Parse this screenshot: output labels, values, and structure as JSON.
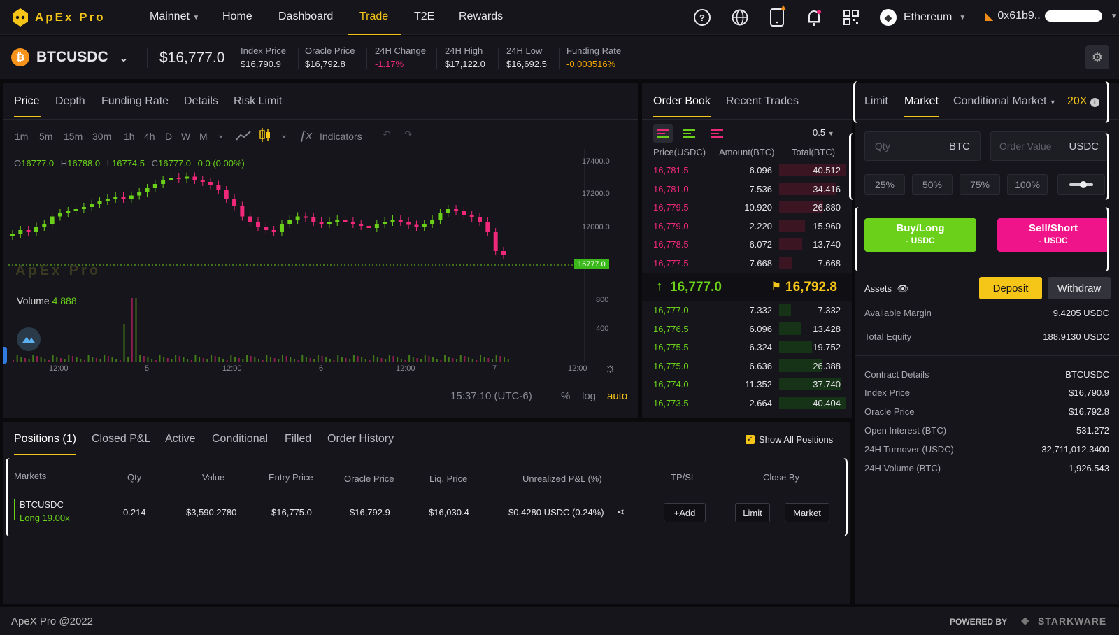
{
  "header": {
    "brand": "ApEx Pro",
    "network": "Mainnet",
    "nav": [
      "Home",
      "Dashboard",
      "Trade",
      "T2E",
      "Rewards"
    ],
    "chain": "Ethereum",
    "wallet": "0x61b9.."
  },
  "ticker": {
    "symbol": "BTCUSDC",
    "last_price": "$16,777.0",
    "stats": [
      {
        "label": "Index Price",
        "value": "$16,790.9"
      },
      {
        "label": "Oracle Price",
        "value": "$16,792.8"
      },
      {
        "label": "24H Change",
        "value": "-1.17%"
      },
      {
        "label": "24H High",
        "value": "$17,122.0"
      },
      {
        "label": "24H Low",
        "value": "$16,692.5"
      },
      {
        "label": "Funding Rate",
        "value": "-0.003516%"
      }
    ]
  },
  "chart": {
    "tabs": [
      "Price",
      "Depth",
      "Funding Rate",
      "Details",
      "Risk Limit"
    ],
    "intervals": [
      "1m",
      "5m",
      "15m",
      "30m",
      "1h",
      "4h",
      "D",
      "W",
      "M"
    ],
    "active_interval": "30m",
    "indicators_label": "Indicators",
    "ohlc": {
      "o_label": "O",
      "o": "16777.0",
      "h_label": "H",
      "h": "16788.0",
      "l_label": "L",
      "l": "16774.5",
      "c_label": "C",
      "c": "16777.0",
      "chg": "0.0 (0.00%)"
    },
    "volume_label": "Volume",
    "volume_value": "4.888",
    "price_ticks": [
      "17400.0",
      "17200.0",
      "17000.0"
    ],
    "last_price_tag": "16777.0",
    "volume_ticks": [
      "800",
      "400"
    ],
    "time_ticks": [
      "12:00",
      "5",
      "12:00",
      "6",
      "12:00",
      "7",
      "12:00"
    ],
    "clock": "15:37:10 (UTC-6)",
    "scale_options": [
      "%",
      "log",
      "auto"
    ],
    "watermark": "ApEx Pro"
  },
  "orderbook": {
    "tabs": [
      "Order Book",
      "Recent Trades"
    ],
    "precision": "0.5",
    "columns": [
      "Price(USDC)",
      "Amount(BTC)",
      "Total(BTC)"
    ],
    "asks": [
      {
        "price": "16,781.5",
        "amount": "6.096",
        "total": "40.512",
        "depth": 1.0
      },
      {
        "price": "16,781.0",
        "amount": "7.536",
        "total": "34.416",
        "depth": 0.85
      },
      {
        "price": "16,779.5",
        "amount": "10.920",
        "total": "26.880",
        "depth": 0.66
      },
      {
        "price": "16,779.0",
        "amount": "2.220",
        "total": "15.960",
        "depth": 0.39
      },
      {
        "price": "16,778.5",
        "amount": "6.072",
        "total": "13.740",
        "depth": 0.34
      },
      {
        "price": "16,777.5",
        "amount": "7.668",
        "total": "7.668",
        "depth": 0.19
      }
    ],
    "mid_last": "16,777.0",
    "mid_mark": "16,792.8",
    "bids": [
      {
        "price": "16,777.0",
        "amount": "7.332",
        "total": "7.332",
        "depth": 0.18
      },
      {
        "price": "16,776.5",
        "amount": "6.096",
        "total": "13.428",
        "depth": 0.33
      },
      {
        "price": "16,775.5",
        "amount": "6.324",
        "total": "19.752",
        "depth": 0.49
      },
      {
        "price": "16,775.0",
        "amount": "6.636",
        "total": "26.388",
        "depth": 0.65
      },
      {
        "price": "16,774.0",
        "amount": "11.352",
        "total": "37.740",
        "depth": 0.93
      },
      {
        "price": "16,773.5",
        "amount": "2.664",
        "total": "40.404",
        "depth": 1.0
      }
    ]
  },
  "trade": {
    "tabs": [
      "Limit",
      "Market",
      "Conditional Market"
    ],
    "leverage": "20X",
    "qty_placeholder": "Qty",
    "qty_unit": "BTC",
    "value_placeholder": "Order Value",
    "value_unit": "USDC",
    "percents": [
      "25%",
      "50%",
      "75%",
      "100%"
    ],
    "buy_label": "Buy/Long",
    "buy_sub": "- USDC",
    "sell_label": "Sell/Short",
    "sell_sub": "- USDC",
    "assets_label": "Assets",
    "deposit": "Deposit",
    "withdraw": "Withdraw",
    "account": [
      {
        "k": "Available Margin",
        "v": "9.4205 USDC"
      },
      {
        "k": "Total Equity",
        "v": "188.9130 USDC"
      }
    ],
    "contract": [
      {
        "k": "Contract Details",
        "v": "BTCUSDC"
      },
      {
        "k": "Index Price",
        "v": "$16,790.9"
      },
      {
        "k": "Oracle Price",
        "v": "$16,792.8"
      },
      {
        "k": "Open Interest (BTC)",
        "v": "531.272"
      },
      {
        "k": "24H Turnover (USDC)",
        "v": "32,711,012.3400"
      },
      {
        "k": "24H Volume (BTC)",
        "v": "1,926.543"
      }
    ]
  },
  "positions": {
    "tabs": [
      "Positions (1)",
      "Closed P&L",
      "Active",
      "Conditional",
      "Filled",
      "Order History"
    ],
    "show_all": "Show All Positions",
    "columns": [
      "Markets",
      "Qty",
      "Value",
      "Entry Price",
      "Oracle Price",
      "Liq. Price",
      "Unrealized P&L (%)",
      "TP/SL",
      "Close By"
    ],
    "row": {
      "market": "BTCUSDC",
      "side": "Long 19.00x",
      "qty": "0.214",
      "value": "$3,590.2780",
      "entry": "$16,775.0",
      "oracle": "$16,792.9",
      "liq": "$16,030.4",
      "pnl": "$0.4280 USDC (0.24%)",
      "add": "+Add",
      "close_limit": "Limit",
      "close_market": "Market"
    }
  },
  "footer": {
    "copyright": "ApeX Pro @2022",
    "powered": "POWERED BY",
    "partner": "STARKWARE"
  },
  "colors": {
    "accent": "#f5c518",
    "up": "#6bd01a",
    "down": "#f0287a",
    "bg": "#15151b"
  }
}
